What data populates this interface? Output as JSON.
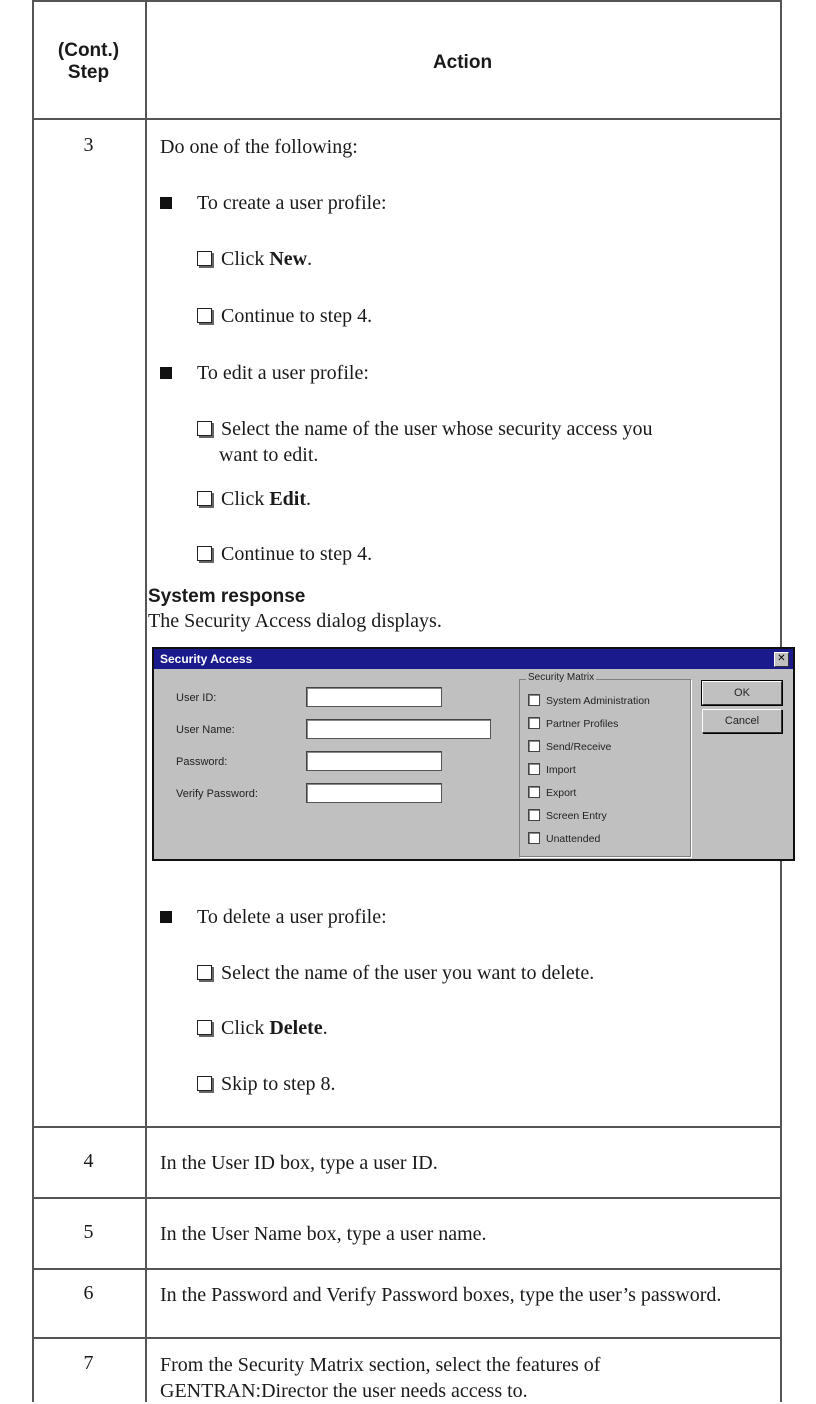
{
  "header": {
    "step_line1": "(Cont.)",
    "step_line2": "Step",
    "action": "Action"
  },
  "step3": {
    "number": "3",
    "intro": "Do one of the following:",
    "create": {
      "label": "To create a user profile:",
      "items": [
        {
          "pre": "Click ",
          "bold": "New",
          "post": "."
        },
        {
          "pre": "Continue to step 4.",
          "bold": "",
          "post": ""
        }
      ]
    },
    "edit": {
      "label": "To edit a user profile:",
      "items": [
        {
          "line1": "Select the name of the user whose security access you",
          "line2": "want to edit."
        },
        {
          "pre": "Click ",
          "bold": "Edit",
          "post": "."
        },
        {
          "pre": "Continue to step 4.",
          "bold": "",
          "post": ""
        }
      ]
    },
    "system_response_heading": "System response",
    "system_response_text": "The Security Access dialog displays.",
    "delete": {
      "label": "To delete a user profile:",
      "items": [
        {
          "pre": "Select the name of the user you want to delete.",
          "bold": "",
          "post": ""
        },
        {
          "pre": "Click ",
          "bold": "Delete",
          "post": "."
        },
        {
          "pre": "Skip to step 8.",
          "bold": "",
          "post": ""
        }
      ]
    }
  },
  "dialog": {
    "title": "Security Access",
    "close_glyph": "✕",
    "fields": {
      "user_id": {
        "label": "User ID:",
        "value": ""
      },
      "user_name": {
        "label": "User Name:",
        "value": ""
      },
      "password": {
        "label": "Password:",
        "value": ""
      },
      "verify_password": {
        "label": "Verify Password:",
        "value": ""
      }
    },
    "matrix_title": "Security Matrix",
    "matrix_items": [
      "System Administration",
      "Partner Profiles",
      "Send/Receive",
      "Import",
      "Export",
      "Screen Entry",
      "Unattended"
    ],
    "ok_label": "OK",
    "cancel_label": "Cancel"
  },
  "steps": [
    {
      "number": "4",
      "text": "In the User ID box, type a user ID."
    },
    {
      "number": "5",
      "text": "In the User Name box, type a user name."
    },
    {
      "number": "6",
      "text": "In the Password and Verify Password boxes, type the user’s password."
    },
    {
      "number": "7",
      "text": "From the Security Matrix section, select the features of GENTRAN:Director the user needs access to."
    }
  ]
}
